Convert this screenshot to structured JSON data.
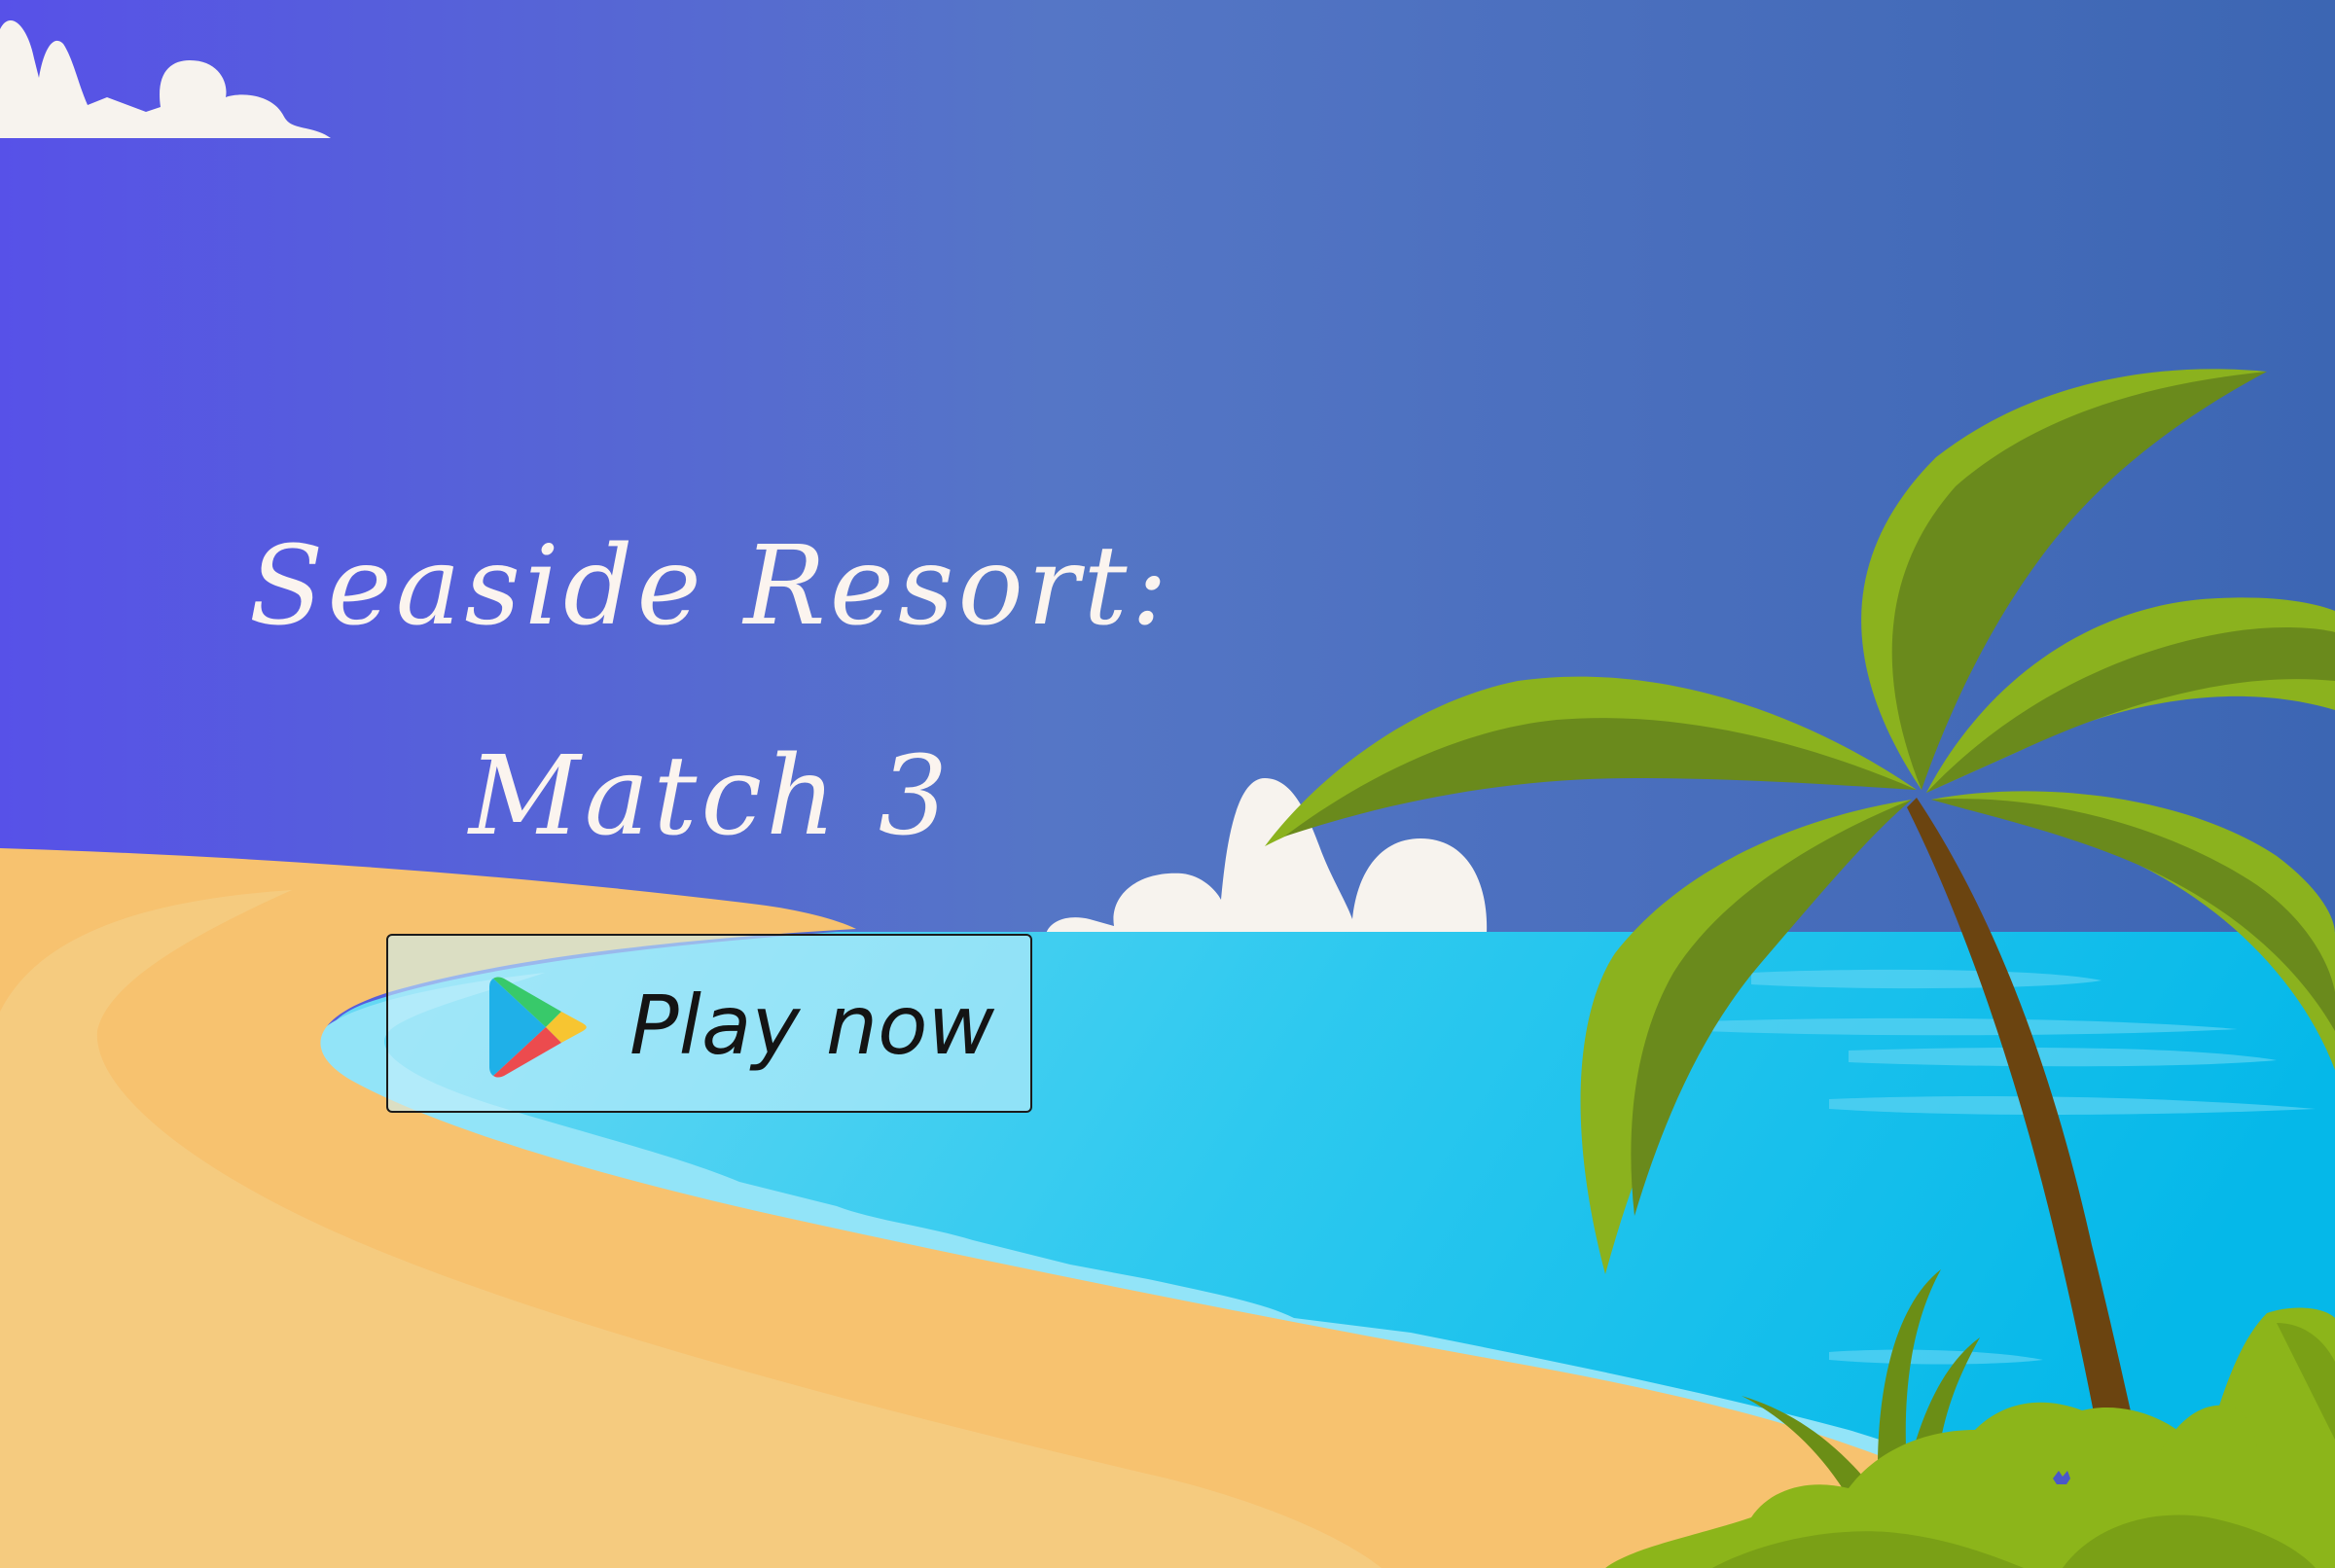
{
  "game": {
    "title_line1": "Seaside Resort:",
    "title_line2": "Match 3",
    "play_button_label": "Play now"
  },
  "icons": {
    "play_store": "google-play-store-icon"
  },
  "colors": {
    "sky_left": "#5751e8",
    "sky_right": "#3c66b3",
    "sand": "#f7c26f",
    "sand_light": "#f5cc82",
    "sea": "#29c6ec",
    "sea_deep": "#05b8e9",
    "foam": "#8fe4f7",
    "cloud": "#f7f3ee",
    "palm_leaf": "#6a8a1c",
    "palm_leaf_light": "#8bb21e",
    "trunk": "#6b4410",
    "bush": "#8cb51a",
    "title_text": "#fbf4ef"
  }
}
